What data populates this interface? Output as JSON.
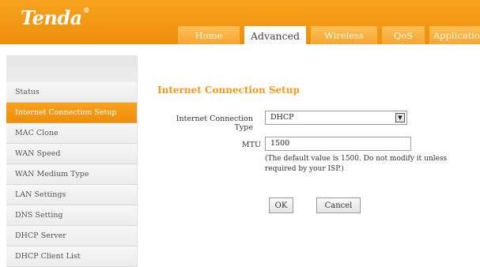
{
  "brand": {
    "logo_text": "Tenda",
    "logo_mark": "®"
  },
  "tabs": [
    {
      "label": "Home"
    },
    {
      "label": "Advanced"
    },
    {
      "label": "Wireless"
    },
    {
      "label": "QoS"
    },
    {
      "label": "Applications"
    }
  ],
  "active_tab": "Advanced",
  "sidebar": {
    "items": [
      {
        "label": "Status"
      },
      {
        "label": "Internet Connection Setup"
      },
      {
        "label": "MAC Clone"
      },
      {
        "label": "WAN Speed"
      },
      {
        "label": "WAN Medium Type"
      },
      {
        "label": "LAN Settings"
      },
      {
        "label": "DNS Setting"
      },
      {
        "label": "DHCP Server"
      },
      {
        "label": "DHCP Client List"
      }
    ],
    "active": "Internet Connection Setup"
  },
  "main": {
    "title": "Internet Connection Setup",
    "connection_type": {
      "label": "Internet Connection Type",
      "value": "DHCP"
    },
    "mtu": {
      "label": "MTU",
      "value": "1500"
    },
    "hint": "(The default value is 1500. Do not modify it unless required by your ISP.)",
    "ok_label": "OK",
    "cancel_label": "Cancel"
  },
  "colors": {
    "accent": "#F29A1F",
    "header": "#F39814",
    "active_item": "#EF8E0C"
  }
}
